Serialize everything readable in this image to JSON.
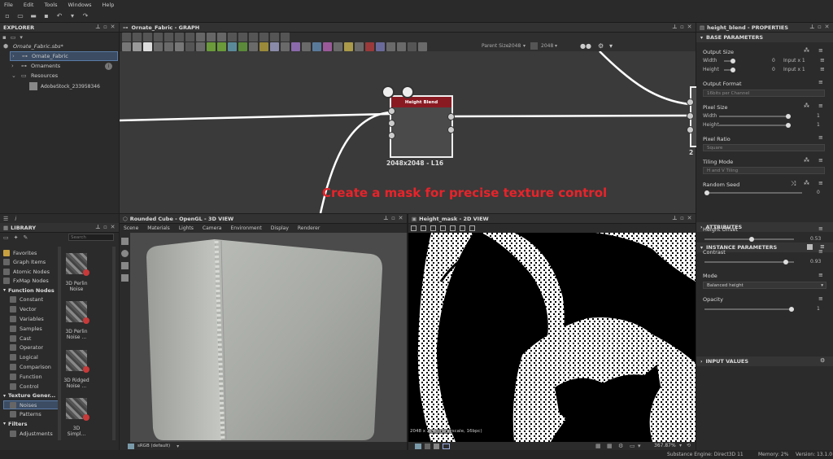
{
  "menubar": {
    "items": [
      "File",
      "Edit",
      "Tools",
      "Windows",
      "Help"
    ]
  },
  "explorer": {
    "title": "EXPLORER",
    "items": [
      {
        "label": "Ornate_Fabric.sbs*"
      },
      {
        "label": "Ornate_Fabric"
      },
      {
        "label": "Ornaments"
      },
      {
        "label": "Resources"
      },
      {
        "label": "AdobeStock_233958346"
      }
    ]
  },
  "graph": {
    "title": "Ornate_Fabric - GRAPH",
    "parent_size_label": "Parent Size:",
    "parent_size_value": "2048",
    "size_value": "2048",
    "node_title": "Height Blend",
    "node_size": "2048x2048 - L16",
    "right_node_size": "2"
  },
  "caption": "Create a mask for precise texture control",
  "library": {
    "title": "LIBRARY",
    "search_placeholder": "Search",
    "categories": [
      "Favorites",
      "Graph Items",
      "Atomic Nodes",
      "FxMap Nodes"
    ],
    "function_header": "Function Nodes",
    "function_items": [
      "Constant",
      "Vector",
      "Variables",
      "Samples",
      "Cast",
      "Operator",
      "Logical",
      "Comparison",
      "Function",
      "Control"
    ],
    "texture_header": "Texture Gener...",
    "texture_items": [
      "Noises",
      "Patterns"
    ],
    "filters_header": "Filters",
    "filter_items": [
      "Adjustments"
    ],
    "thumbs": [
      {
        "label1": "3D Perlin",
        "label2": "Noise"
      },
      {
        "label1": "3D Perlin",
        "label2": "Noise ..."
      },
      {
        "label1": "3D Ridged",
        "label2": "Noise ..."
      },
      {
        "label1": "3D",
        "label2": "Simpl..."
      }
    ]
  },
  "view3d": {
    "title": "Rounded Cube - OpenGL - 3D VIEW",
    "menu": [
      "Scene",
      "Materials",
      "Lights",
      "Camera",
      "Environment",
      "Display",
      "Renderer"
    ],
    "colorspace": "sRGB (default)"
  },
  "view2d": {
    "title": "Height_mask - 2D VIEW",
    "info": "2048 x 2048 (Grayscale, 16bpc)",
    "zoom": "367.87%"
  },
  "properties": {
    "title": "height_blend - PROPERTIES",
    "base_section": "BASE PARAMETERS",
    "output_size": {
      "label": "Output Size",
      "width_label": "Width",
      "height_label": "Height",
      "width_val": "0",
      "height_val": "0",
      "width_mode": "Input x 1",
      "height_mode": "Input x 1"
    },
    "output_format": {
      "label": "Output Format",
      "value": "16bits per Channel"
    },
    "pixel_size": {
      "label": "Pixel Size",
      "width_label": "Width",
      "height_label": "Height",
      "width_val": "1",
      "height_val": "1"
    },
    "pixel_ratio": {
      "label": "Pixel Ratio",
      "value": "Square"
    },
    "tiling_mode": {
      "label": "Tiling Mode",
      "value": "H and V Tiling"
    },
    "random_seed": {
      "label": "Random Seed",
      "value": "0"
    },
    "attributes_section": "ATTRIBUTES",
    "instance_section": "INSTANCE PARAMETERS",
    "height_offset": {
      "label": "Height Offset",
      "value": "0.53",
      "level": 0.53
    },
    "contrast": {
      "label": "Contrast",
      "value": "0.93",
      "level": 0.93
    },
    "mode": {
      "label": "Mode",
      "value": "Balanced height"
    },
    "opacity": {
      "label": "Opacity",
      "value": "1",
      "level": 1.0
    },
    "input_section": "INPUT VALUES"
  },
  "statusbar": {
    "engine": "Substance Engine: Direct3D 11",
    "memory": "Memory: 2%",
    "version": "Version: 13.1.0"
  },
  "colors": {
    "caption": "#e8232a",
    "node_header": "#8a1a22",
    "selection": "#3b4c63"
  }
}
